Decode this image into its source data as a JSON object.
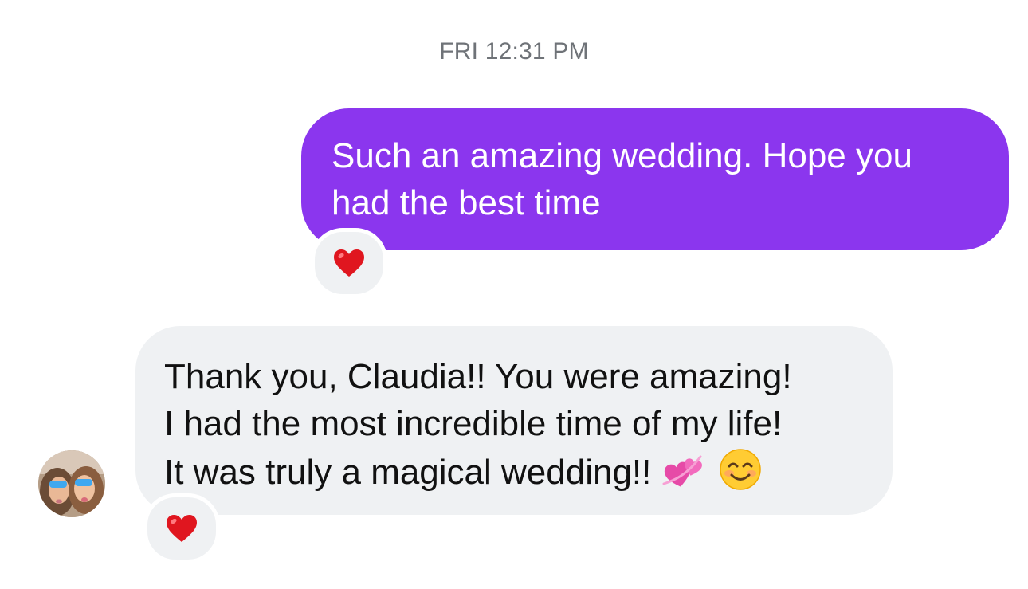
{
  "conversation": {
    "timestamp": "FRI 12:31 PM",
    "messages": [
      {
        "direction": "sent",
        "lines": [
          "Such an amazing wedding. Hope you",
          "had the best time"
        ],
        "reaction": "red-heart",
        "bubble_color": "#8b36ee"
      },
      {
        "direction": "received",
        "lines": [
          "Thank you, Claudia!! You were amazing!",
          "I had the most incredible time of my life!",
          "It was truly a magical wedding!!"
        ],
        "trailing_emojis": [
          "two-hearts",
          "smiling-face"
        ],
        "reaction": "red-heart",
        "bubble_color": "#eff1f3"
      }
    ]
  },
  "colors": {
    "accent": "#8b36ee",
    "received_bubble": "#eff1f3",
    "timestamp_text": "#6f7378"
  }
}
